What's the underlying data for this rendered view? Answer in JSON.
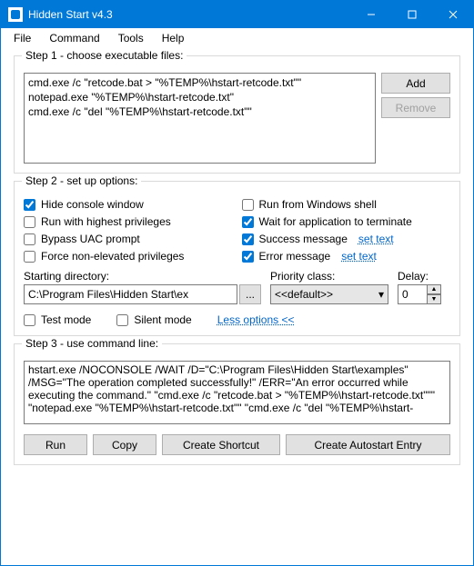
{
  "title": "Hidden Start v4.3",
  "menu": {
    "file": "File",
    "command": "Command",
    "tools": "Tools",
    "help": "Help"
  },
  "step1": {
    "legend": "Step 1 - choose executable files:",
    "lines": [
      "cmd.exe /c \"retcode.bat > \"%TEMP%\\hstart-retcode.txt\"\"",
      "notepad.exe \"%TEMP%\\hstart-retcode.txt\"",
      "cmd.exe /c \"del \"%TEMP%\\hstart-retcode.txt\"\""
    ],
    "add": "Add",
    "remove": "Remove"
  },
  "step2": {
    "legend": "Step 2 - set up options:",
    "hide_console": "Hide console window",
    "run_highest": "Run with highest privileges",
    "bypass_uac": "Bypass UAC prompt",
    "force_nonelev": "Force non-elevated privileges",
    "run_shell": "Run from Windows shell",
    "wait_term": "Wait for application to terminate",
    "success_msg": "Success message",
    "error_msg": "Error message",
    "set_text": "set text",
    "start_dir_label": "Starting directory:",
    "start_dir_value": "C:\\Program Files\\Hidden Start\\ex",
    "browse": "...",
    "priority_label": "Priority class:",
    "priority_value": "<<default>>",
    "delay_label": "Delay:",
    "delay_value": "0",
    "test_mode": "Test mode",
    "silent_mode": "Silent mode",
    "less_options": "Less options <<",
    "checked": {
      "hide_console": true,
      "run_highest": false,
      "bypass_uac": false,
      "force_nonelev": false,
      "run_shell": false,
      "wait_term": true,
      "success_msg": true,
      "error_msg": true,
      "test_mode": false,
      "silent_mode": false
    }
  },
  "step3": {
    "legend": "Step 3 - use command line:",
    "cmdline": "hstart.exe /NOCONSOLE /WAIT /D=\"C:\\Program Files\\Hidden Start\\examples\" /MSG=\"The operation completed successfully!\" /ERR=\"An error occurred while executing the command.\" \"cmd.exe /c \"retcode.bat > \"%TEMP%\\hstart-retcode.txt\"\"\" \"notepad.exe \"%TEMP%\\hstart-retcode.txt\"\" \"cmd.exe /c \"del \"%TEMP%\\hstart-",
    "run": "Run",
    "copy": "Copy",
    "shortcut": "Create Shortcut",
    "autostart": "Create Autostart Entry"
  }
}
